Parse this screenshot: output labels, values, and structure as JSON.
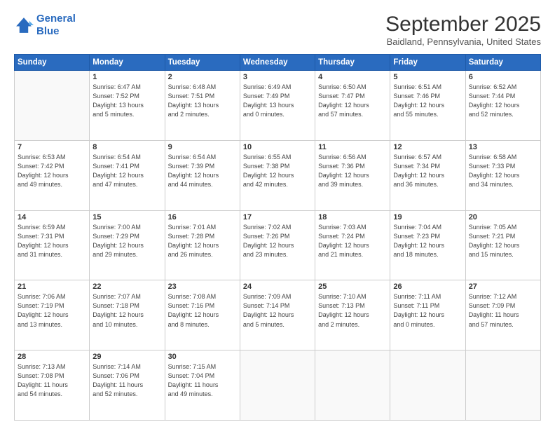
{
  "header": {
    "logo_line1": "General",
    "logo_line2": "Blue",
    "title": "September 2025",
    "subtitle": "Baidland, Pennsylvania, United States"
  },
  "calendar": {
    "days_of_week": [
      "Sunday",
      "Monday",
      "Tuesday",
      "Wednesday",
      "Thursday",
      "Friday",
      "Saturday"
    ],
    "weeks": [
      [
        {
          "day": "",
          "info": ""
        },
        {
          "day": "1",
          "info": "Sunrise: 6:47 AM\nSunset: 7:52 PM\nDaylight: 13 hours\nand 5 minutes."
        },
        {
          "day": "2",
          "info": "Sunrise: 6:48 AM\nSunset: 7:51 PM\nDaylight: 13 hours\nand 2 minutes."
        },
        {
          "day": "3",
          "info": "Sunrise: 6:49 AM\nSunset: 7:49 PM\nDaylight: 13 hours\nand 0 minutes."
        },
        {
          "day": "4",
          "info": "Sunrise: 6:50 AM\nSunset: 7:47 PM\nDaylight: 12 hours\nand 57 minutes."
        },
        {
          "day": "5",
          "info": "Sunrise: 6:51 AM\nSunset: 7:46 PM\nDaylight: 12 hours\nand 55 minutes."
        },
        {
          "day": "6",
          "info": "Sunrise: 6:52 AM\nSunset: 7:44 PM\nDaylight: 12 hours\nand 52 minutes."
        }
      ],
      [
        {
          "day": "7",
          "info": "Sunrise: 6:53 AM\nSunset: 7:42 PM\nDaylight: 12 hours\nand 49 minutes."
        },
        {
          "day": "8",
          "info": "Sunrise: 6:54 AM\nSunset: 7:41 PM\nDaylight: 12 hours\nand 47 minutes."
        },
        {
          "day": "9",
          "info": "Sunrise: 6:54 AM\nSunset: 7:39 PM\nDaylight: 12 hours\nand 44 minutes."
        },
        {
          "day": "10",
          "info": "Sunrise: 6:55 AM\nSunset: 7:38 PM\nDaylight: 12 hours\nand 42 minutes."
        },
        {
          "day": "11",
          "info": "Sunrise: 6:56 AM\nSunset: 7:36 PM\nDaylight: 12 hours\nand 39 minutes."
        },
        {
          "day": "12",
          "info": "Sunrise: 6:57 AM\nSunset: 7:34 PM\nDaylight: 12 hours\nand 36 minutes."
        },
        {
          "day": "13",
          "info": "Sunrise: 6:58 AM\nSunset: 7:33 PM\nDaylight: 12 hours\nand 34 minutes."
        }
      ],
      [
        {
          "day": "14",
          "info": "Sunrise: 6:59 AM\nSunset: 7:31 PM\nDaylight: 12 hours\nand 31 minutes."
        },
        {
          "day": "15",
          "info": "Sunrise: 7:00 AM\nSunset: 7:29 PM\nDaylight: 12 hours\nand 29 minutes."
        },
        {
          "day": "16",
          "info": "Sunrise: 7:01 AM\nSunset: 7:28 PM\nDaylight: 12 hours\nand 26 minutes."
        },
        {
          "day": "17",
          "info": "Sunrise: 7:02 AM\nSunset: 7:26 PM\nDaylight: 12 hours\nand 23 minutes."
        },
        {
          "day": "18",
          "info": "Sunrise: 7:03 AM\nSunset: 7:24 PM\nDaylight: 12 hours\nand 21 minutes."
        },
        {
          "day": "19",
          "info": "Sunrise: 7:04 AM\nSunset: 7:23 PM\nDaylight: 12 hours\nand 18 minutes."
        },
        {
          "day": "20",
          "info": "Sunrise: 7:05 AM\nSunset: 7:21 PM\nDaylight: 12 hours\nand 15 minutes."
        }
      ],
      [
        {
          "day": "21",
          "info": "Sunrise: 7:06 AM\nSunset: 7:19 PM\nDaylight: 12 hours\nand 13 minutes."
        },
        {
          "day": "22",
          "info": "Sunrise: 7:07 AM\nSunset: 7:18 PM\nDaylight: 12 hours\nand 10 minutes."
        },
        {
          "day": "23",
          "info": "Sunrise: 7:08 AM\nSunset: 7:16 PM\nDaylight: 12 hours\nand 8 minutes."
        },
        {
          "day": "24",
          "info": "Sunrise: 7:09 AM\nSunset: 7:14 PM\nDaylight: 12 hours\nand 5 minutes."
        },
        {
          "day": "25",
          "info": "Sunrise: 7:10 AM\nSunset: 7:13 PM\nDaylight: 12 hours\nand 2 minutes."
        },
        {
          "day": "26",
          "info": "Sunrise: 7:11 AM\nSunset: 7:11 PM\nDaylight: 12 hours\nand 0 minutes."
        },
        {
          "day": "27",
          "info": "Sunrise: 7:12 AM\nSunset: 7:09 PM\nDaylight: 11 hours\nand 57 minutes."
        }
      ],
      [
        {
          "day": "28",
          "info": "Sunrise: 7:13 AM\nSunset: 7:08 PM\nDaylight: 11 hours\nand 54 minutes."
        },
        {
          "day": "29",
          "info": "Sunrise: 7:14 AM\nSunset: 7:06 PM\nDaylight: 11 hours\nand 52 minutes."
        },
        {
          "day": "30",
          "info": "Sunrise: 7:15 AM\nSunset: 7:04 PM\nDaylight: 11 hours\nand 49 minutes."
        },
        {
          "day": "",
          "info": ""
        },
        {
          "day": "",
          "info": ""
        },
        {
          "day": "",
          "info": ""
        },
        {
          "day": "",
          "info": ""
        }
      ]
    ]
  }
}
